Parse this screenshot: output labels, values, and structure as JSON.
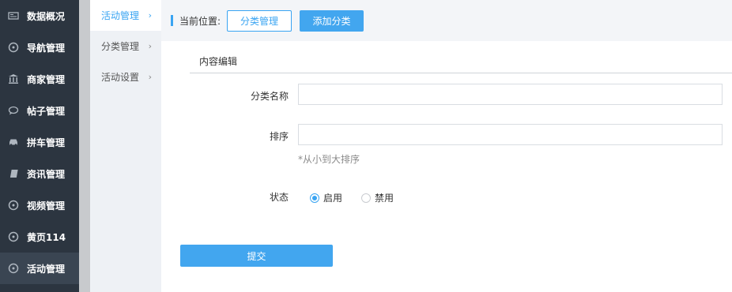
{
  "sidebar": {
    "items": [
      {
        "label": "数据概况",
        "icon": "newspaper-icon"
      },
      {
        "label": "导航管理",
        "icon": "compass-icon"
      },
      {
        "label": "商家管理",
        "icon": "bank-icon"
      },
      {
        "label": "帖子管理",
        "icon": "chat-bubble-icon"
      },
      {
        "label": "拼车管理",
        "icon": "car-icon"
      },
      {
        "label": "资讯管理",
        "icon": "book-icon"
      },
      {
        "label": "视频管理",
        "icon": "compass-icon"
      },
      {
        "label": "黄页114",
        "icon": "compass-icon"
      },
      {
        "label": "活动管理",
        "icon": "compass-icon",
        "active": true
      }
    ]
  },
  "submenu": {
    "items": [
      {
        "label": "活动管理",
        "active": true
      },
      {
        "label": "分类管理"
      },
      {
        "label": "活动设置"
      }
    ],
    "chevron": "›"
  },
  "topbar": {
    "location_label": "当前位置:",
    "breadcrumb_button": "分类管理",
    "add_button": "添加分类"
  },
  "section": {
    "title": "内容编辑"
  },
  "form": {
    "name_label": "分类名称",
    "name_value": "",
    "sort_label": "排序",
    "sort_value": "",
    "sort_hint": "*从小到大排序",
    "status_label": "状态",
    "status_options": [
      {
        "label": "启用",
        "checked": true
      },
      {
        "label": "禁用",
        "checked": false
      }
    ],
    "submit_label": "提交"
  },
  "colors": {
    "accent": "#39a4f2",
    "sidebar_bg": "#2c3540"
  }
}
